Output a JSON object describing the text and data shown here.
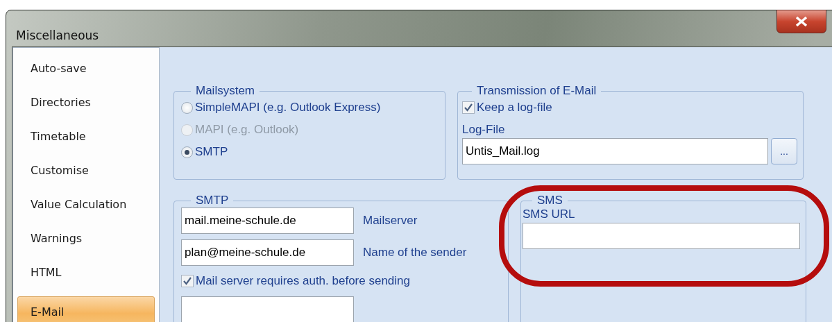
{
  "window": {
    "title": "Miscellaneous"
  },
  "sidebar": {
    "items": [
      {
        "label": "Auto-save",
        "selected": false
      },
      {
        "label": "Directories",
        "selected": false
      },
      {
        "label": "Timetable",
        "selected": false
      },
      {
        "label": "Customise",
        "selected": false
      },
      {
        "label": "Value Calculation",
        "selected": false
      },
      {
        "label": "Warnings",
        "selected": false
      },
      {
        "label": "HTML",
        "selected": false
      },
      {
        "label": "E-Mail",
        "selected": true
      }
    ]
  },
  "mailsystem": {
    "title": "Mailsystem",
    "options": [
      {
        "label": "SimpleMAPI (e.g. Outlook Express)",
        "selected": false,
        "disabled": false
      },
      {
        "label": "MAPI (e.g. Outlook)",
        "selected": false,
        "disabled": true
      },
      {
        "label": "SMTP",
        "selected": true,
        "disabled": false
      }
    ]
  },
  "transmission": {
    "title": "Transmission of E-Mail",
    "keep_log": {
      "label": "Keep a log-file",
      "checked": true
    },
    "log_file_label": "Log-File",
    "log_file": "Untis_Mail.log",
    "browse_button": "..."
  },
  "smtp": {
    "title": "SMTP",
    "fields": [
      {
        "value": "mail.meine-schule.de",
        "label": "Mailserver"
      },
      {
        "value": "plan@meine-schule.de",
        "label": "Name of the sender"
      }
    ],
    "auth": {
      "label": "Mail server requires auth. before sending",
      "checked": true
    }
  },
  "sms": {
    "title": "SMS",
    "url_label": "SMS URL",
    "highlighted": true
  }
}
